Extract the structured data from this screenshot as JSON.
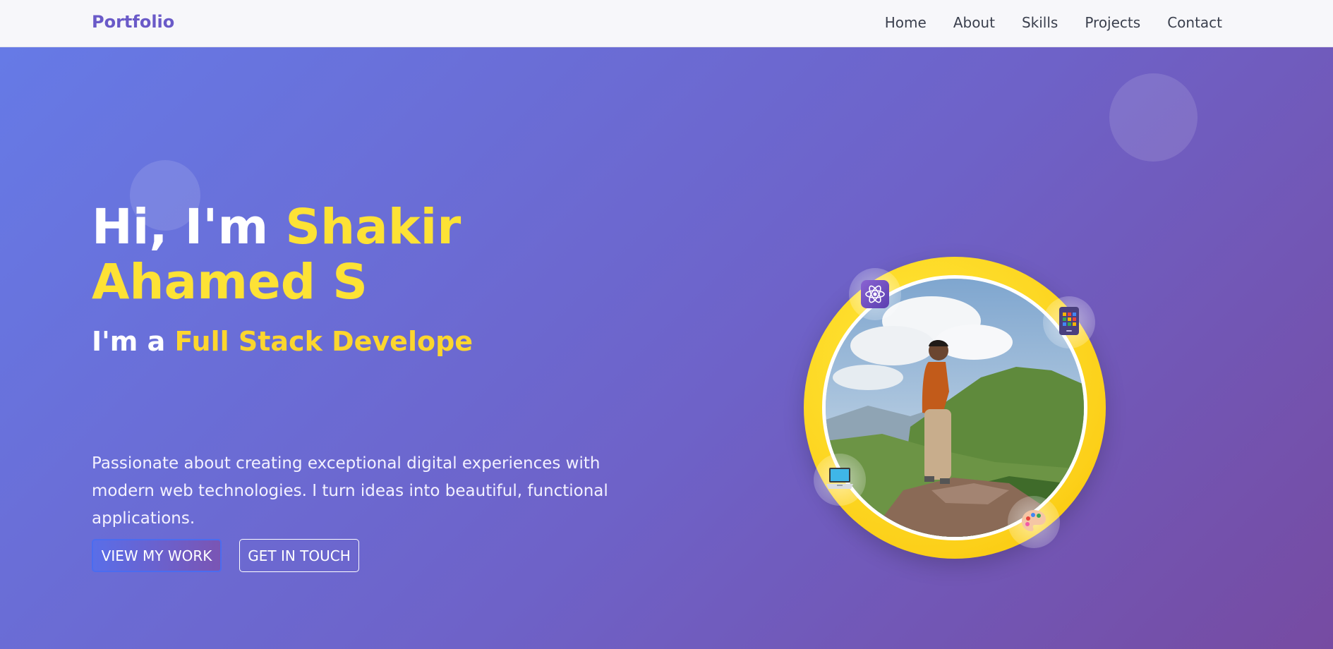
{
  "navbar": {
    "logo": "Portfolio",
    "links": [
      "Home",
      "About",
      "Skills",
      "Projects",
      "Contact"
    ]
  },
  "hero": {
    "greeting": "Hi, I'm ",
    "name": "Shakir Ahamed S",
    "role_prefix": "I'm a ",
    "role": "Full Stack Develope",
    "description": "Passionate about creating exceptional digital experiences with modern web technologies. I turn ideas into beautiful, functional applications.",
    "buttons": {
      "primary": "VIEW MY WORK",
      "secondary": "GET IN TOUCH"
    }
  },
  "profile": {
    "badges": [
      "atom-icon",
      "mobile-icon",
      "laptop-icon",
      "palette-icon"
    ]
  },
  "colors": {
    "accent": "#fde235",
    "brand": "#6a5ac8",
    "gradient_start": "#667ae6",
    "gradient_end": "#764ba2"
  }
}
